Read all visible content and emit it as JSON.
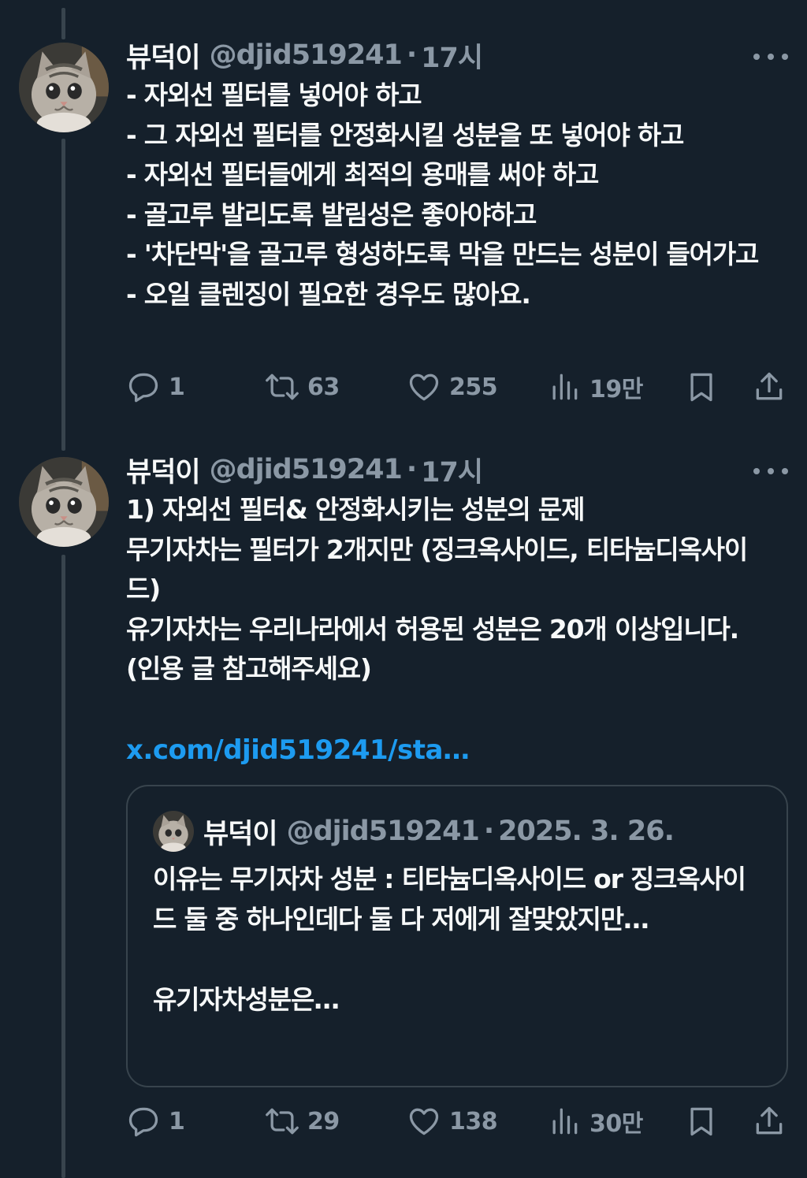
{
  "tweets": [
    {
      "display_name": "뷰덕이",
      "handle": "@djid519241",
      "separator": "·",
      "time": "17시",
      "text": "- 자외선 필터를 넣어야 하고\n- 그 자외선 필터를 안정화시킬 성분을 또 넣어야 하고\n- 자외선 필터들에게 최적의 용매를 써야 하고\n- 골고루 발리도록 발림성은 좋아야하고\n- '차단막'을 골고루 형성하도록 막을 만드는 성분이 들어가고\n- 오일 클렌징이 필요한 경우도 많아요.",
      "metrics": {
        "replies": "1",
        "retweets": "63",
        "likes": "255",
        "views": "19만"
      }
    },
    {
      "display_name": "뷰덕이",
      "handle": "@djid519241",
      "separator": "·",
      "time": "17시",
      "text": "1) 자외선 필터& 안정화시키는 성분의 문제\n무기자차는 필터가 2개지만 (징크옥사이드, 티타늄디옥사이드)\n유기자차는 우리나라에서 허용된 성분은 20개 이상입니다. (인용 글 참고해주세요)",
      "link": "x.com/djid519241/sta…",
      "quote": {
        "display_name": "뷰덕이",
        "handle": "@djid519241",
        "separator": "·",
        "date": "2025. 3. 26.",
        "text": "이유는 무기자차 성분 : 티타늄디옥사이드 or 징크옥사이드 둘 중 하나인데다 둘 다 저에게 잘맞았지만…\n\n유기자차성분은…"
      },
      "metrics": {
        "replies": "1",
        "retweets": "29",
        "likes": "138",
        "views": "30만"
      }
    }
  ],
  "icons": {
    "avatar": "cat-avatar",
    "more": "more-dots-icon",
    "reply": "reply-icon",
    "retweet": "retweet-icon",
    "like": "heart-icon",
    "views": "views-bar-chart-icon",
    "bookmark": "bookmark-icon",
    "share": "share-upload-icon"
  },
  "colors": {
    "background": "#15202b",
    "text": "#f7f9f9",
    "secondary": "#8b98a5",
    "link": "#1d9bf0",
    "border": "#38444d"
  }
}
